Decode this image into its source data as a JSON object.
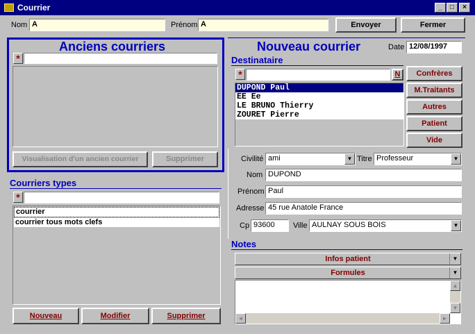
{
  "window": {
    "title": "Courrier"
  },
  "header": {
    "nom_label": "Nom",
    "nom_value": "A",
    "prenom_label": "Prénom",
    "prenom_value": "A",
    "envoyer_label": "Envoyer",
    "fermer_label": "Fermer"
  },
  "anciens": {
    "title": "Anciens courriers",
    "visualisation_label": "Visualisation d'un ancien courrier",
    "supprimer_label": "Supprimer"
  },
  "types": {
    "title": "Courriers types",
    "items": [
      "courrier",
      "courrier tous mots clefs"
    ],
    "nouveau_label": "Nouveau",
    "modifier_label": "Modifier",
    "supprimer_label": "Supprimer"
  },
  "nouveau": {
    "title": "Nouveau courrier",
    "date_label": "Date",
    "date_value": "12/08/1997",
    "destinataire_title": "Destinataire",
    "n_button": "N",
    "recipients": [
      "DUPOND  Paul",
      "EE  Ee",
      "LE BRUNO  Thierry",
      "ZOURET  Pierre"
    ],
    "side_buttons": [
      "Confrères",
      "M.Traitants",
      "Autres",
      "Patient",
      "Vide"
    ],
    "civilite_label": "Civilité",
    "civilite_value": "ami",
    "titre_label": "Titre",
    "titre_value": "Professeur",
    "nom_label": "Nom",
    "nom_value": "DUPOND",
    "prenom_label": "Prénom",
    "prenom_value": "Paul",
    "adresse_label": "Adresse",
    "adresse_value": "45 rue Anatole France",
    "cp_label": "Cp",
    "cp_value": "93600",
    "ville_label": "Ville",
    "ville_value": "AULNAY SOUS BOIS"
  },
  "notes": {
    "title": "Notes",
    "infos_label": "Infos patient",
    "formules_label": "Formules"
  },
  "colors": {
    "title_bar": "#000080",
    "accent_blue": "#0000c0",
    "button_text_red": "#800000",
    "yellow_field": "#ffffe0"
  }
}
